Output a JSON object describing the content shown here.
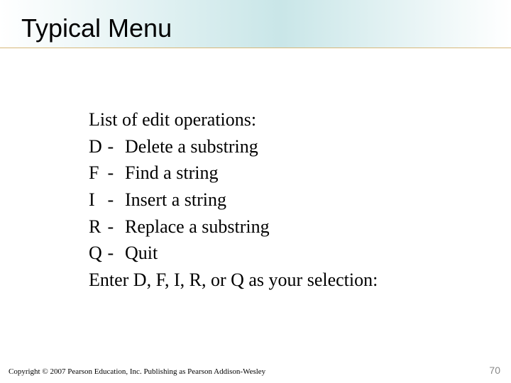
{
  "title": "Typical Menu",
  "heading": "List of edit operations:",
  "items": [
    {
      "key": "D",
      "desc": "Delete a substring"
    },
    {
      "key": "F",
      "desc": "Find a string"
    },
    {
      "key": "I",
      "desc": "Insert a string"
    },
    {
      "key": "R",
      "desc": "Replace a substring"
    },
    {
      "key": "Q",
      "desc": "Quit"
    }
  ],
  "prompt": "Enter D, F, I, R, or Q as your selection:",
  "footer": "Copyright © 2007 Pearson Education, Inc. Publishing as Pearson Addison-Wesley",
  "page_number": "70"
}
